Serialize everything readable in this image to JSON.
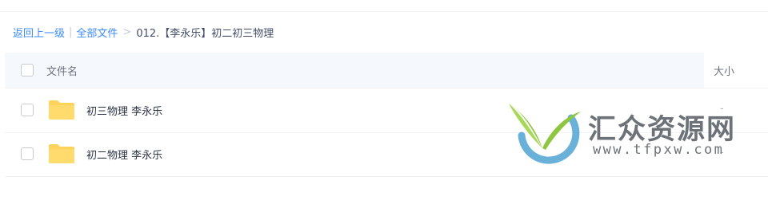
{
  "breadcrumb": {
    "back_label": "返回上一级",
    "separator_pipe": "|",
    "all_files_label": "全部文件",
    "separator_arrow": ">",
    "current_folder": "012.【李永乐】初二初三物理"
  },
  "table": {
    "header": {
      "name_col": "文件名",
      "size_col": "大小"
    },
    "rows": [
      {
        "name": "初三物理 李永乐",
        "size": "-",
        "icon": "folder-icon"
      },
      {
        "name": "初二物理 李永乐",
        "size": "-",
        "icon": "folder-icon"
      }
    ]
  },
  "watermark": {
    "title": "汇众资源网",
    "url": "www.tfpxw.com"
  },
  "colors": {
    "link": "#3b8cff",
    "folder": "#ffd35a",
    "header_bg": "#f5f8fc",
    "divider": "#f0f2f5",
    "watermark_text": "#6c7278",
    "logo_leaf": "#8ec63f",
    "logo_ring": "#5aa8d6"
  }
}
